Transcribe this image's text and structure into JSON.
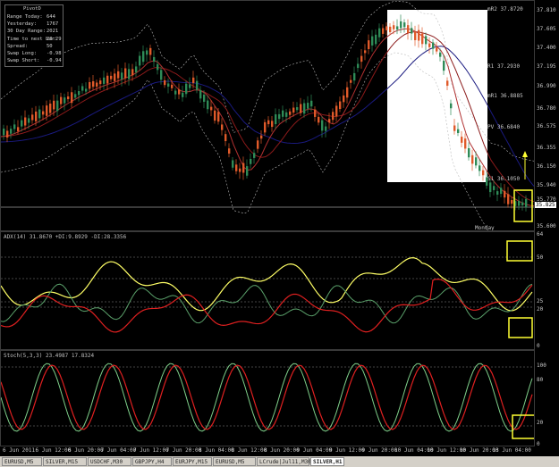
{
  "pivot_panel": {
    "title": "PivotD",
    "rows": [
      {
        "label": "Range  Today:",
        "value": "644"
      },
      {
        "label": "Yesterday:",
        "value": "1767"
      },
      {
        "label": "30 Day Range:",
        "value": "2021"
      },
      {
        "label": "Time to next bar:",
        "value": "23:29"
      },
      {
        "label": "Spread:",
        "value": "50"
      },
      {
        "label": "Swap  Long:",
        "value": "-0.98"
      },
      {
        "label": "Swap  Short:",
        "value": "-0.94"
      }
    ]
  },
  "main_chart": {
    "price_ticks": [
      "37.810",
      "37.605",
      "37.400",
      "37.195",
      "36.990",
      "36.780",
      "36.575",
      "36.355",
      "36.150",
      "35.940",
      "35.770",
      "35.600"
    ],
    "current_price": "35.825",
    "pivot_labels": [
      {
        "text": "mR2  37.8720"
      },
      {
        "text": "R1  37.2930"
      },
      {
        "text": "mR1  36.8885"
      },
      {
        "text": "PV  36.6840"
      },
      {
        "text": "S1  36.1050"
      }
    ],
    "day_label": "Monday",
    "colors": {
      "bull": "#2e8b57",
      "bear": "#e05a2a",
      "accent_box": "#ffff33"
    }
  },
  "adx_panel": {
    "header": "ADX(14) 31.8670 +DI:9.8929 -DI:28.3356",
    "ticks": [
      "64",
      "50",
      "25",
      "20",
      "0"
    ],
    "colors": {
      "adx": "#ffff66",
      "plus_di": "#5aa06a",
      "minus_di": "#e02020"
    }
  },
  "stoch_panel": {
    "header": "Stoch(5,3,3) 23.4987 17.8324",
    "ticks": [
      "100",
      "80",
      "20",
      "0"
    ],
    "colors": {
      "main": "#7fd08a",
      "signal": "#e02020"
    }
  },
  "time_labels": [
    "6 Jun 2011",
    "6 Jun 12:00",
    "6 Jun 20:00",
    "7 Jun 04:00",
    "7 Jun 12:00",
    "7 Jun 20:00",
    "8 Jun 04:00",
    "8 Jun 12:00",
    "8 Jun 20:00",
    "9 Jun 04:00",
    "9 Jun 12:00",
    "9 Jun 20:00",
    "10 Jun 04:00",
    "10 Jun 12:00",
    "10 Jun 20:00",
    "13 Jun 04:00"
  ],
  "tabs": [
    {
      "label": "EURUSD,M5",
      "active": false
    },
    {
      "label": "SILVER,M15",
      "active": false
    },
    {
      "label": "USDCHF,M30",
      "active": false
    },
    {
      "label": "GBPJPY,H4",
      "active": false
    },
    {
      "label": "EURJPY,M15",
      "active": false
    },
    {
      "label": "EURUSD,M5",
      "active": false
    },
    {
      "label": "LCrude|Jul11,M30",
      "active": false
    },
    {
      "label": "SILVER,H1",
      "active": true
    }
  ]
}
